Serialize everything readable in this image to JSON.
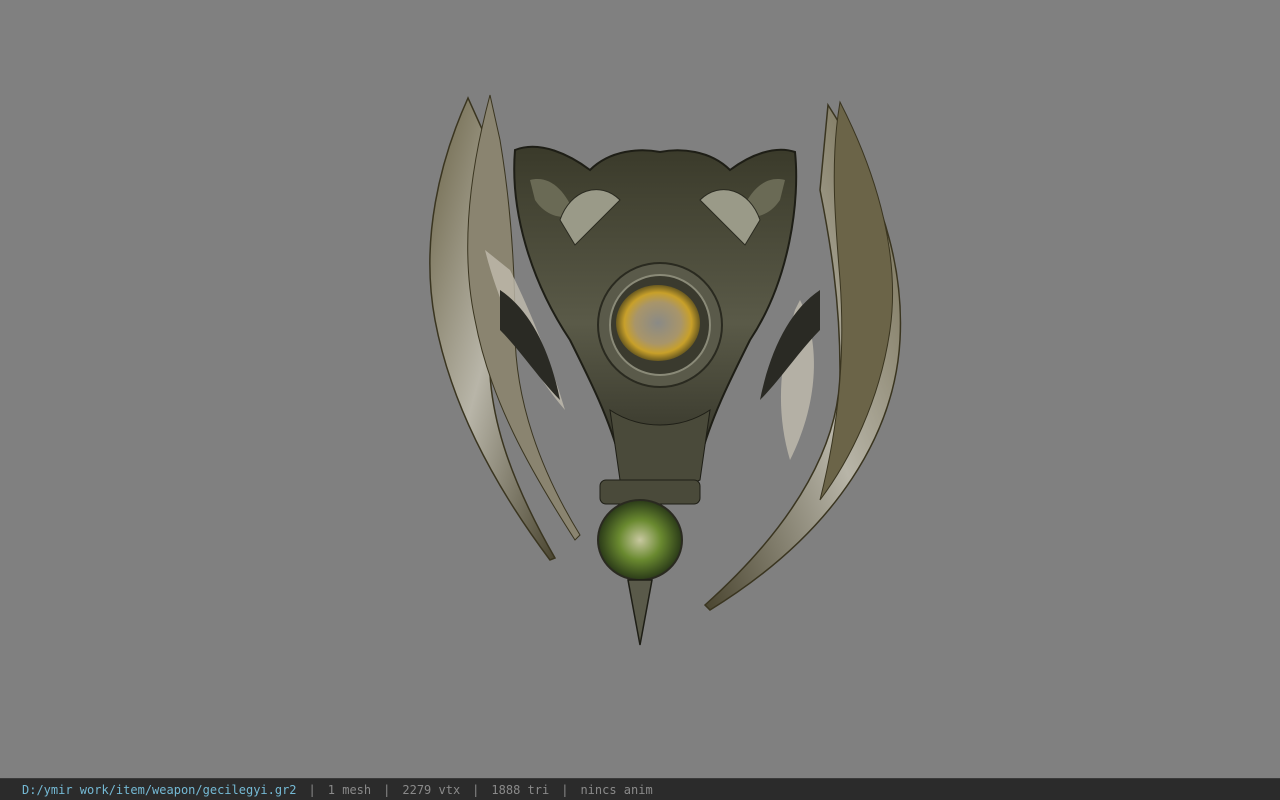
{
  "status_bar": {
    "file_path": "D:/ymir work/item/weapon/gecilegyi.gr2",
    "separator": "|",
    "mesh_count": "1 mesh",
    "vertex_count": "2279 vtx",
    "triangle_count": "1888 tri",
    "anim_status": "nincs anim"
  },
  "model": {
    "icon": "winged-shield-model"
  },
  "colors": {
    "viewport_bg": "#808080",
    "status_bg": "#2b2b2b",
    "path_text": "#74b9d4",
    "stat_text": "#8a8a8a"
  }
}
